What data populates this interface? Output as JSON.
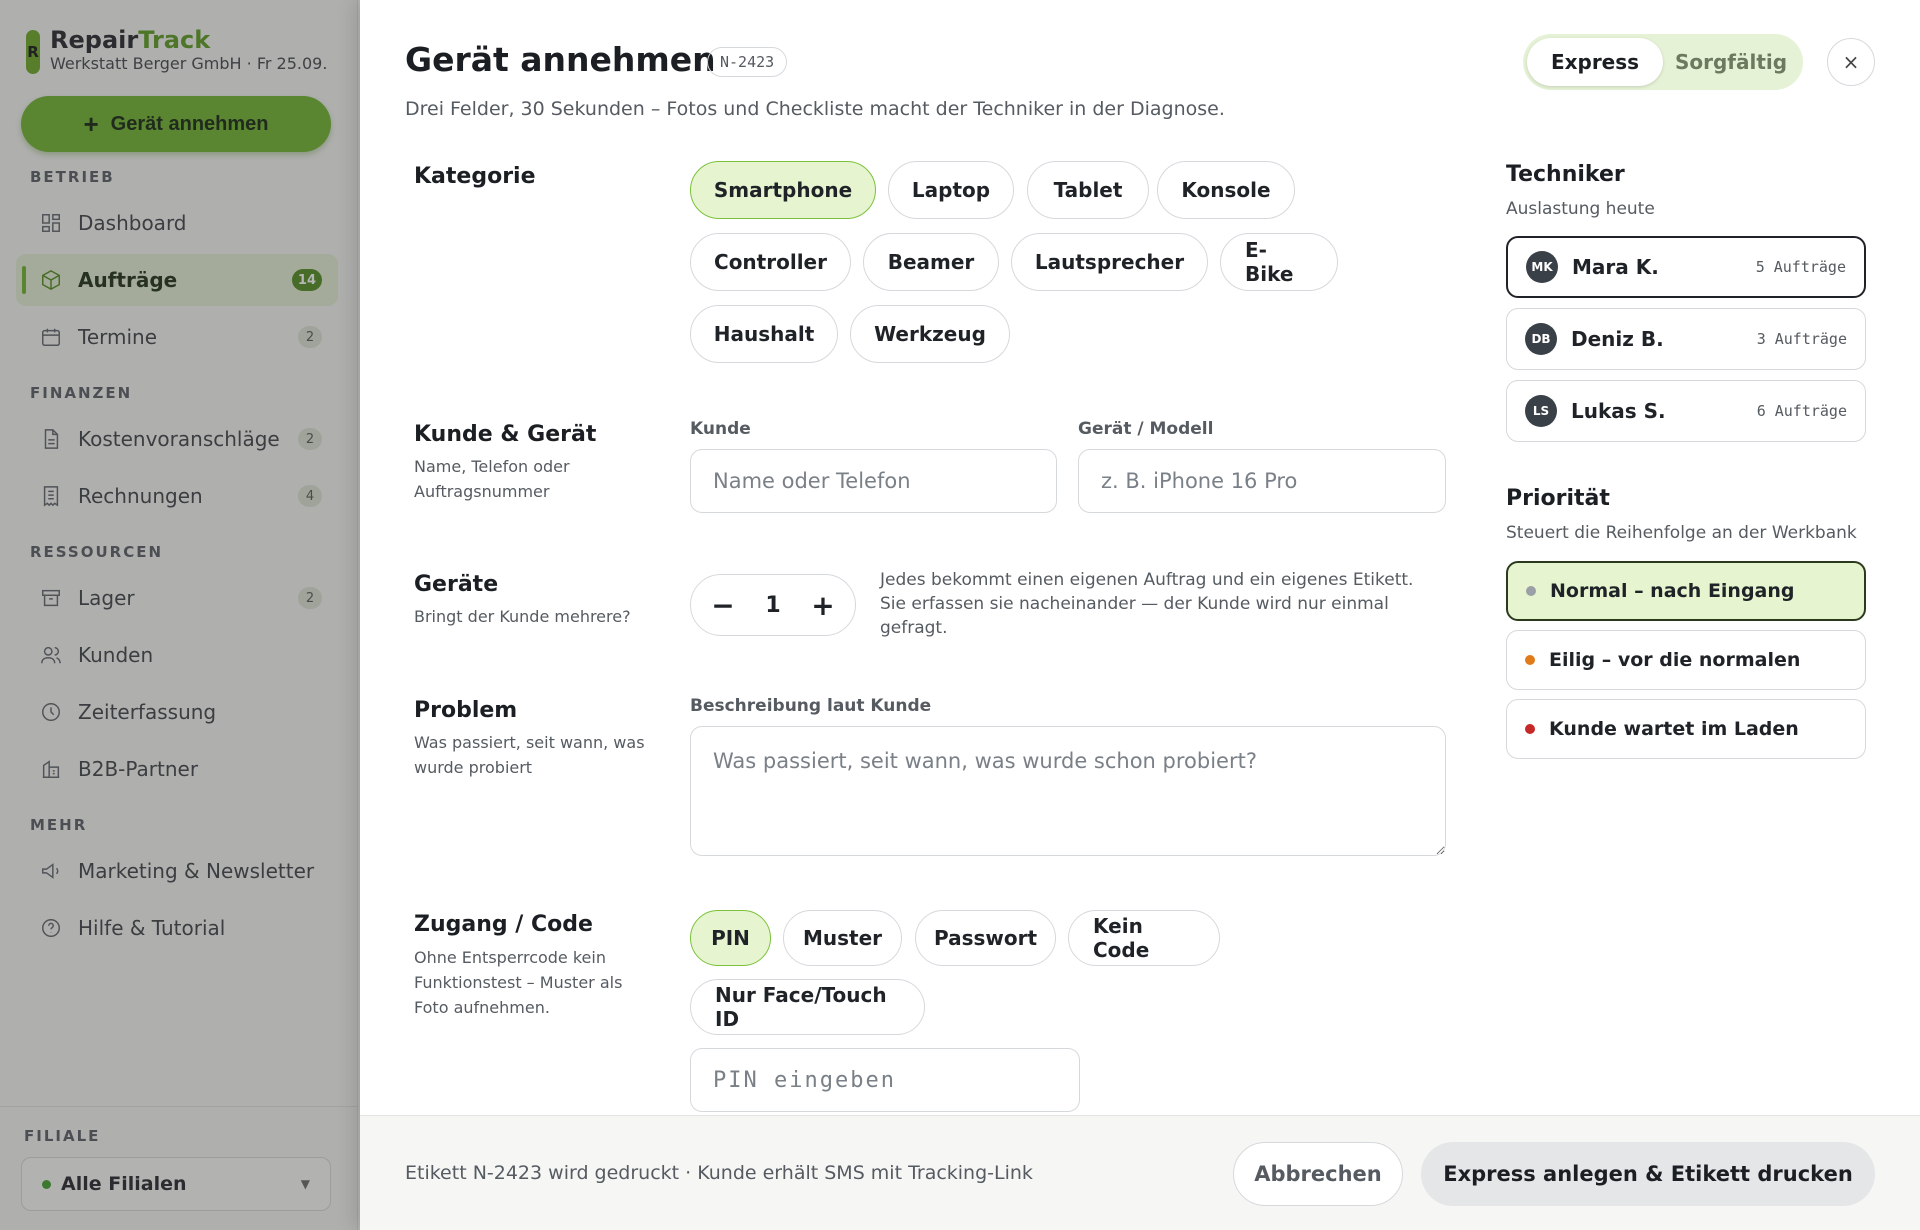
{
  "sidebar": {
    "brand_logo": "R",
    "brand_part1": "Repair",
    "brand_part2": "Track",
    "brand_sub": "Werkstatt Berger GmbH · Fr 25.09.",
    "new_button": "Gerät annehmen",
    "sections": {
      "betrieb": "BETRIEB",
      "finanzen": "FINANZEN",
      "ressourcen": "RESSOURCEN",
      "mehr": "MEHR"
    },
    "items": [
      {
        "label": "Dashboard",
        "icon": "dashboard-icon"
      },
      {
        "label": "Aufträge",
        "icon": "box-icon",
        "count": "14",
        "active": true
      },
      {
        "label": "Termine",
        "icon": "calendar-icon",
        "count": "2"
      },
      {
        "label": "Kostenvoranschläge",
        "icon": "document-icon",
        "count": "2"
      },
      {
        "label": "Rechnungen",
        "icon": "receipt-icon",
        "count": "4"
      },
      {
        "label": "Lager",
        "icon": "archive-icon",
        "count": "2"
      },
      {
        "label": "Kunden",
        "icon": "users-icon"
      },
      {
        "label": "Zeiterfassung",
        "icon": "clock-icon"
      },
      {
        "label": "B2B-Partner",
        "icon": "building-icon"
      },
      {
        "label": "Marketing & Newsletter",
        "icon": "megaphone-icon"
      },
      {
        "label": "Hilfe & Tutorial",
        "icon": "help-icon"
      }
    ],
    "filiale_label": "FILIALE",
    "filiale_value": "Alle Filialen"
  },
  "panel": {
    "title": "Gerät annehmen",
    "order_id": "N-2423",
    "subtitle": "Drei Felder, 30 Sekunden – Fotos und Checkliste macht der Techniker in der Diagnose.",
    "modes": [
      "Express",
      "Sorgfältig"
    ],
    "selected_mode": "Express",
    "close_icon": "×"
  },
  "kategorie": {
    "label": "Kategorie",
    "options": [
      "Smartphone",
      "Laptop",
      "Tablet",
      "Konsole",
      "Controller",
      "Beamer",
      "Lautsprecher",
      "E-Bike",
      "Haushalt",
      "Werkzeug"
    ],
    "selected": "Smartphone"
  },
  "kunde": {
    "label": "Kunde & Gerät",
    "help": "Name, Telefon oder Auftragsnummer",
    "customer_label": "Kunde",
    "customer_placeholder": "Name oder Telefon",
    "customer_value": "",
    "device_label": "Gerät / Modell",
    "device_placeholder": "z. B. iPhone 16 Pro",
    "device_value": ""
  },
  "geraete": {
    "label": "Geräte",
    "help": "Bringt der Kunde mehrere?",
    "minus": "−",
    "plus": "+",
    "count": "1",
    "note": "Jedes bekommt einen eigenen Auftrag und ein eigenes Etikett. Sie erfassen sie nacheinander — der Kunde wird nur einmal gefragt."
  },
  "problem": {
    "label": "Problem",
    "help": "Was passiert, seit wann, was wurde probiert",
    "field_label": "Beschreibung laut Kunde",
    "placeholder": "Was passiert, seit wann, was wurde schon probiert?",
    "value": ""
  },
  "zugang": {
    "label": "Zugang / Code",
    "help": "Ohne Entsperrcode kein Funktionstest – Muster als Foto aufnehmen.",
    "options": [
      "PIN",
      "Muster",
      "Passwort",
      "Kein Code",
      "Nur Face/Touch ID"
    ],
    "selected": "PIN",
    "pin_placeholder": "PIN eingeben",
    "pin_value": ""
  },
  "techniker": {
    "title": "Techniker",
    "subtitle": "Auslastung heute",
    "people": [
      {
        "initials": "MK",
        "name": "Mara K.",
        "load": "5 Aufträge",
        "selected": true
      },
      {
        "initials": "DB",
        "name": "Deniz B.",
        "load": "3 Aufträge"
      },
      {
        "initials": "LS",
        "name": "Lukas S.",
        "load": "6 Aufträge"
      }
    ]
  },
  "prioritaet": {
    "title": "Priorität",
    "subtitle": "Steuert die Reihenfolge an der Werkbank",
    "options": [
      {
        "label": "Normal – nach Eingang",
        "color": "#9aa0a6",
        "selected": true
      },
      {
        "label": "Eilig – vor die normalen",
        "color": "#e07b1a"
      },
      {
        "label": "Kunde wartet im Laden",
        "color": "#c62828"
      }
    ]
  },
  "footer": {
    "info": "Etikett N-2423 wird gedruckt · Kunde erhält SMS mit Tracking-Link",
    "cancel": "Abbrechen",
    "submit": "Express anlegen & Etikett drucken"
  },
  "colors": {
    "accent": "#6cb22a",
    "selected_bg": "#e6f5cf",
    "text": "#1f2328"
  }
}
